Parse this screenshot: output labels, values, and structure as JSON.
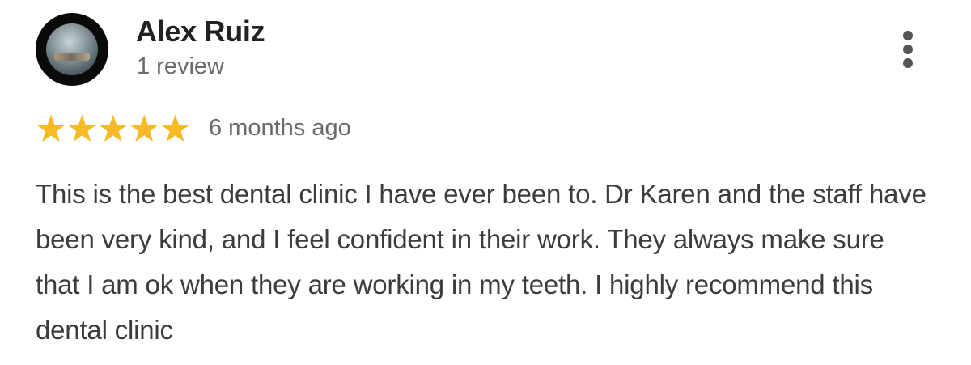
{
  "reviewer": {
    "name": "Alex Ruiz",
    "meta": "1 review",
    "avatar_icon": "profile-photo"
  },
  "menu": {
    "icon": "more-vertical-icon"
  },
  "rating": {
    "stars": 5,
    "max_stars": 5,
    "star_color": "#F7B924",
    "time": "6 months ago"
  },
  "review": {
    "text": "This is the best dental clinic I have ever been to. Dr Karen and the staff have been very kind, and I feel confident in their work. They always make sure that I am ok when they are working in my teeth. I highly recommend this dental clinic"
  }
}
